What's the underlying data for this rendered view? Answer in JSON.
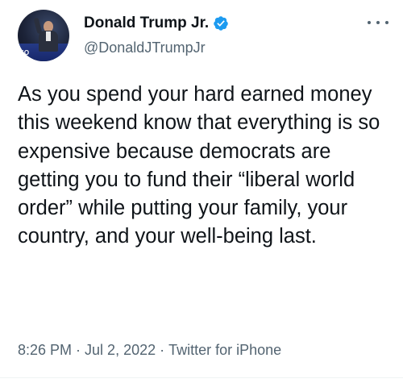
{
  "author": {
    "display_name": "Donald Trump Jr.",
    "handle": "@DonaldJTrumpJr",
    "verified": true,
    "avatar_stage_text": "YO"
  },
  "tweet": {
    "text": "As you spend your hard earned money this weekend know that everything is so expensive because democrats are getting you to fund their “liberal world order” while putting your family, your country, and your well-being last."
  },
  "meta": {
    "time": "8:26 PM",
    "date": "Jul 2, 2022",
    "source": "Twitter for iPhone",
    "separator": "·"
  },
  "icons": {
    "verified": "verified-badge-icon",
    "more": "more-options-icon"
  },
  "colors": {
    "verified_blue": "#1d9bf0",
    "text_primary": "#0f1419",
    "text_secondary": "#536471"
  }
}
